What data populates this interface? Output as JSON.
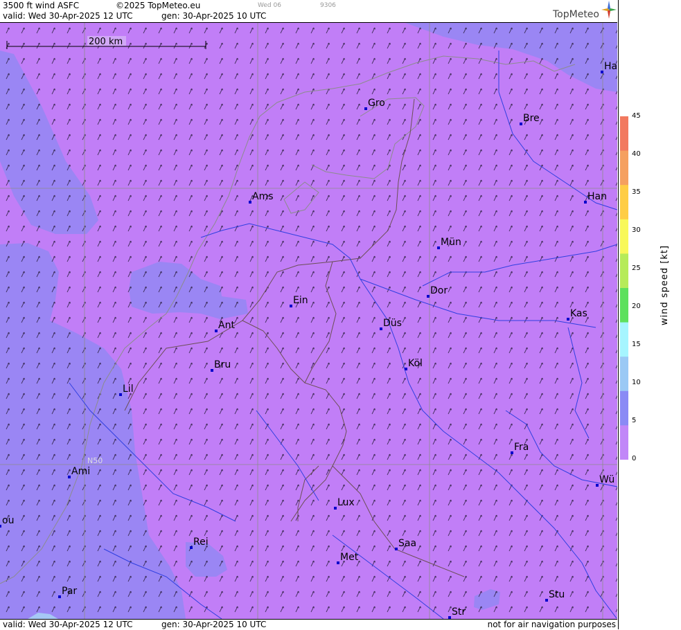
{
  "header": {
    "title": "3500 ft wind ASFC",
    "copyright": "©2025 TopMeteo.eu",
    "day_code": "Wed 06",
    "code": "9306",
    "valid": "valid:  Wed  30-Apr-2025  12 UTC",
    "gen": "gen: 30-Apr-2025 10 UTC",
    "brand": "TopMeteo"
  },
  "footer": {
    "valid": "valid:  Wed  30-Apr-2025  12 UTC",
    "gen": "gen: 30-Apr-2025 10 UTC",
    "disclaimer": "not for air navigation purposes"
  },
  "scale_bar": {
    "label": "200 km"
  },
  "graticule": {
    "lat_label": "N50"
  },
  "colorbar": {
    "title": "wind  speed  [kt]",
    "ticks": [
      "45",
      "40",
      "35",
      "30",
      "25",
      "20",
      "15",
      "10",
      "5",
      "0"
    ],
    "colors": [
      "#f2795f",
      "#f5a060",
      "#ffcd45",
      "#f8f85a",
      "#b6eb5a",
      "#5ee05e",
      "#a6f5ff",
      "#9bc9f5",
      "#8a8af5",
      "#c187f8"
    ]
  },
  "colors": {
    "light_purple": "#c17ef7",
    "blue_purple": "#9a86f4",
    "city_marker": "#0000cc"
  },
  "cities": [
    {
      "name": "Gro"
    },
    {
      "name": "Bre"
    },
    {
      "name": "Ha"
    },
    {
      "name": "Ams"
    },
    {
      "name": "Han"
    },
    {
      "name": "Mün"
    },
    {
      "name": "Dor"
    },
    {
      "name": "Ein"
    },
    {
      "name": "Kas"
    },
    {
      "name": "Ant"
    },
    {
      "name": "Düs"
    },
    {
      "name": "Bru"
    },
    {
      "name": "Köl"
    },
    {
      "name": "Lil"
    },
    {
      "name": "Fra"
    },
    {
      "name": "Ami"
    },
    {
      "name": "Wü"
    },
    {
      "name": "ou"
    },
    {
      "name": "Lux"
    },
    {
      "name": "Rei"
    },
    {
      "name": "Saa"
    },
    {
      "name": "Met"
    },
    {
      "name": "Par"
    },
    {
      "name": "Stu"
    },
    {
      "name": "Str"
    }
  ]
}
